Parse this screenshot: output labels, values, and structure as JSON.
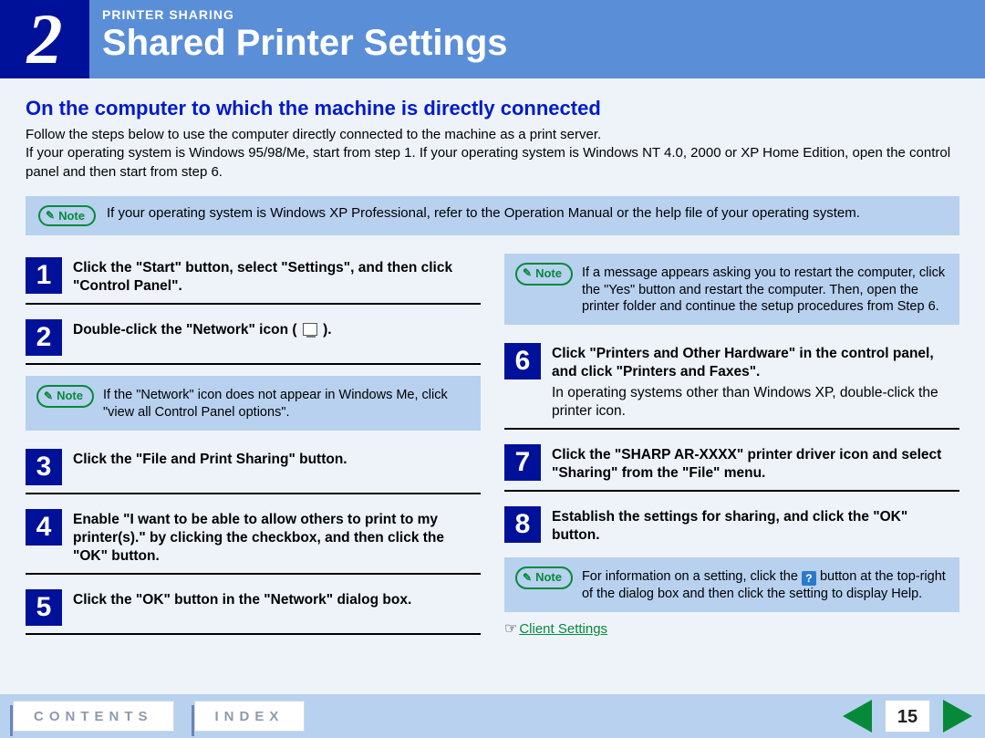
{
  "header": {
    "chapter_number": "2",
    "kicker": "PRINTER SHARING",
    "title": "Shared Printer Settings"
  },
  "section_heading": "On the computer to which the machine is directly connected",
  "intro": "Follow the steps below to use the computer directly connected to the machine as a print server.\nIf your operating system is Windows 95/98/Me, start from step 1. If your operating system is Windows NT 4.0, 2000 or XP Home Edition, open the control panel and then start from step 6.",
  "note_top": {
    "label": "Note",
    "text": "If your operating system is Windows XP Professional, refer to the Operation Manual or the help file of your operating system."
  },
  "left": {
    "steps": [
      {
        "n": "1",
        "text": "Click the \"Start\" button, select \"Settings\", and then click \"Control Panel\"."
      },
      {
        "n": "2",
        "text_pre": "Double-click the \"Network\" icon (",
        "text_post": ")."
      }
    ],
    "note2": {
      "label": "Note",
      "text": "If the \"Network\" icon does not appear in Windows Me, click \"view all Control Panel options\"."
    },
    "steps_b": [
      {
        "n": "3",
        "text": "Click the \"File and Print Sharing\" button."
      },
      {
        "n": "4",
        "text": "Enable \"I want to be able to allow others to print to my printer(s).\" by clicking the checkbox, and then click the \"OK\" button."
      },
      {
        "n": "5",
        "text": "Click the \"OK\" button in the \"Network\" dialog box."
      }
    ]
  },
  "right": {
    "note_restart": {
      "label": "Note",
      "text": "If a message appears asking you to restart the computer, click the \"Yes\" button and restart the computer. Then, open the printer folder and continue the setup procedures from Step 6."
    },
    "steps": [
      {
        "n": "6",
        "text": "Click \"Printers and Other Hardware\" in the control panel, and click \"Printers and Faxes\".",
        "sub": "In operating systems other than Windows XP, double-click the printer icon."
      },
      {
        "n": "7",
        "text": "Click the \"SHARP AR-XXXX\" printer driver icon and select \"Sharing\" from the \"File\" menu."
      },
      {
        "n": "8",
        "text": "Establish the settings for sharing, and click the \"OK\" button."
      }
    ],
    "note_help": {
      "label": "Note",
      "text_pre": "For information on a setting, click the ",
      "text_post": " button at the top-right of the dialog box and then click the setting to display Help.",
      "help_glyph": "?"
    },
    "client_link": "Client Settings"
  },
  "footer": {
    "contents": "CONTENTS",
    "index": "INDEX",
    "page": "15"
  }
}
